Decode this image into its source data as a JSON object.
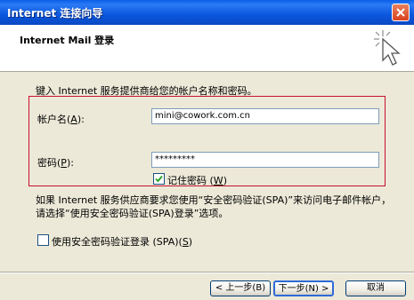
{
  "window": {
    "title": "Internet 连接向导"
  },
  "header": {
    "title": "Internet Mail 登录"
  },
  "intro": "键入 Internet 服务提供商给您的帐户名称和密码。",
  "account": {
    "label": "帐户名(",
    "hotkey": "A",
    "label_end": "):",
    "value": "mini@cowork.com.cn"
  },
  "password": {
    "label": "密码(",
    "hotkey": "P",
    "label_end": "):",
    "value": "*********"
  },
  "remember": {
    "label": "记住密码 (",
    "hotkey": "W",
    "label_end": ")",
    "checked": true
  },
  "spa_note": "如果 Internet 服务供应商要求您使用“安全密码验证(SPA)”来访问电子邮件帐户，请选择“使用安全密码验证(SPA)登录”选项。",
  "spa": {
    "label": "使用安全密码验证登录 (SPA)(",
    "hotkey": "S",
    "label_end": ")",
    "checked": false
  },
  "buttons": {
    "back": "< 上一步(B)",
    "next": "下一步(N) >",
    "cancel": "取消"
  },
  "colors": {
    "titlebar": "#0a57dd",
    "highlight_box": "#c8102e",
    "dialog_bg": "#ece9d8"
  }
}
